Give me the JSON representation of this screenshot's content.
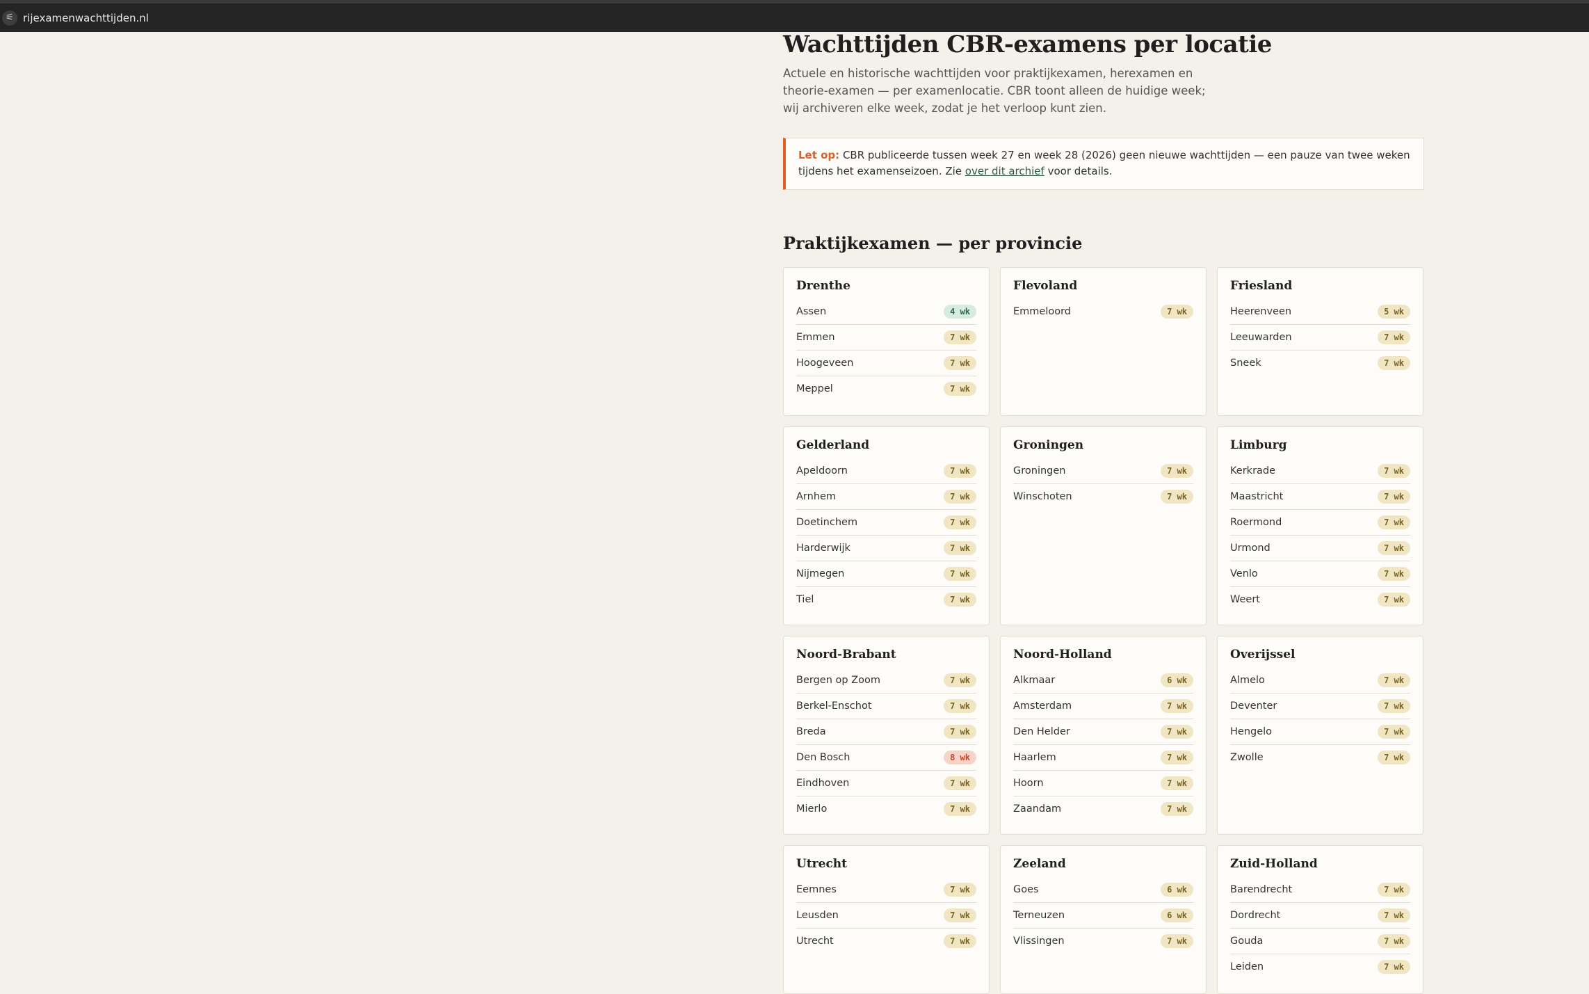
{
  "browser": {
    "url": "rijexamenwachttijden.nl",
    "site_icon": "tune-icon"
  },
  "page": {
    "title": "Wachttijden CBR-examens per locatie",
    "lead": "Actuele en historische wachttijden voor praktijkexamen, herexamen en theorie-examen — per examenlocatie. CBR toont alleen de huidige week; wij archiveren elke week, zodat je het verloop kunt zien."
  },
  "notice": {
    "label": "Let op:",
    "text_before": " CBR publiceerde tussen week 27 en week 28 (2026) geen nieuwe wachttijden — een pauze van twee weken tijdens het examenseizoen. Zie ",
    "link": "over dit archief",
    "text_after": " voor details."
  },
  "section": {
    "title": "Praktijkexamen — per provincie"
  },
  "colors": {
    "accent": "#d9622b",
    "badge_default": "#f1e6c4",
    "badge_low": "#d7ece0",
    "badge_high": "#f7d4c8"
  },
  "provinces": [
    {
      "name": "Drenthe",
      "locations": [
        {
          "name": "Assen",
          "wait": "4 wk",
          "level": "green"
        },
        {
          "name": "Emmen",
          "wait": "7 wk",
          "level": "default"
        },
        {
          "name": "Hoogeveen",
          "wait": "7 wk",
          "level": "default"
        },
        {
          "name": "Meppel",
          "wait": "7 wk",
          "level": "default"
        }
      ]
    },
    {
      "name": "Flevoland",
      "locations": [
        {
          "name": "Emmeloord",
          "wait": "7 wk",
          "level": "default"
        }
      ]
    },
    {
      "name": "Friesland",
      "locations": [
        {
          "name": "Heerenveen",
          "wait": "5 wk",
          "level": "default"
        },
        {
          "name": "Leeuwarden",
          "wait": "7 wk",
          "level": "default"
        },
        {
          "name": "Sneek",
          "wait": "7 wk",
          "level": "default"
        }
      ]
    },
    {
      "name": "Gelderland",
      "locations": [
        {
          "name": "Apeldoorn",
          "wait": "7 wk",
          "level": "default"
        },
        {
          "name": "Arnhem",
          "wait": "7 wk",
          "level": "default"
        },
        {
          "name": "Doetinchem",
          "wait": "7 wk",
          "level": "default"
        },
        {
          "name": "Harderwijk",
          "wait": "7 wk",
          "level": "default"
        },
        {
          "name": "Nijmegen",
          "wait": "7 wk",
          "level": "default"
        },
        {
          "name": "Tiel",
          "wait": "7 wk",
          "level": "default"
        }
      ]
    },
    {
      "name": "Groningen",
      "locations": [
        {
          "name": "Groningen",
          "wait": "7 wk",
          "level": "default"
        },
        {
          "name": "Winschoten",
          "wait": "7 wk",
          "level": "default"
        }
      ]
    },
    {
      "name": "Limburg",
      "locations": [
        {
          "name": "Kerkrade",
          "wait": "7 wk",
          "level": "default"
        },
        {
          "name": "Maastricht",
          "wait": "7 wk",
          "level": "default"
        },
        {
          "name": "Roermond",
          "wait": "7 wk",
          "level": "default"
        },
        {
          "name": "Urmond",
          "wait": "7 wk",
          "level": "default"
        },
        {
          "name": "Venlo",
          "wait": "7 wk",
          "level": "default"
        },
        {
          "name": "Weert",
          "wait": "7 wk",
          "level": "default"
        }
      ]
    },
    {
      "name": "Noord-Brabant",
      "locations": [
        {
          "name": "Bergen op Zoom",
          "wait": "7 wk",
          "level": "default"
        },
        {
          "name": "Berkel-Enschot",
          "wait": "7 wk",
          "level": "default"
        },
        {
          "name": "Breda",
          "wait": "7 wk",
          "level": "default"
        },
        {
          "name": "Den Bosch",
          "wait": "8 wk",
          "level": "red"
        },
        {
          "name": "Eindhoven",
          "wait": "7 wk",
          "level": "default"
        },
        {
          "name": "Mierlo",
          "wait": "7 wk",
          "level": "default"
        }
      ]
    },
    {
      "name": "Noord-Holland",
      "locations": [
        {
          "name": "Alkmaar",
          "wait": "6 wk",
          "level": "default"
        },
        {
          "name": "Amsterdam",
          "wait": "7 wk",
          "level": "default"
        },
        {
          "name": "Den Helder",
          "wait": "7 wk",
          "level": "default"
        },
        {
          "name": "Haarlem",
          "wait": "7 wk",
          "level": "default"
        },
        {
          "name": "Hoorn",
          "wait": "7 wk",
          "level": "default"
        },
        {
          "name": "Zaandam",
          "wait": "7 wk",
          "level": "default"
        }
      ]
    },
    {
      "name": "Overijssel",
      "locations": [
        {
          "name": "Almelo",
          "wait": "7 wk",
          "level": "default"
        },
        {
          "name": "Deventer",
          "wait": "7 wk",
          "level": "default"
        },
        {
          "name": "Hengelo",
          "wait": "7 wk",
          "level": "default"
        },
        {
          "name": "Zwolle",
          "wait": "7 wk",
          "level": "default"
        }
      ]
    },
    {
      "name": "Utrecht",
      "locations": [
        {
          "name": "Eemnes",
          "wait": "7 wk",
          "level": "default"
        },
        {
          "name": "Leusden",
          "wait": "7 wk",
          "level": "default"
        },
        {
          "name": "Utrecht",
          "wait": "7 wk",
          "level": "default"
        }
      ]
    },
    {
      "name": "Zeeland",
      "locations": [
        {
          "name": "Goes",
          "wait": "6 wk",
          "level": "default"
        },
        {
          "name": "Terneuzen",
          "wait": "6 wk",
          "level": "default"
        },
        {
          "name": "Vlissingen",
          "wait": "7 wk",
          "level": "default"
        }
      ]
    },
    {
      "name": "Zuid-Holland",
      "locations": [
        {
          "name": "Barendrecht",
          "wait": "7 wk",
          "level": "default"
        },
        {
          "name": "Dordrecht",
          "wait": "7 wk",
          "level": "default"
        },
        {
          "name": "Gouda",
          "wait": "7 wk",
          "level": "default"
        },
        {
          "name": "Leiden",
          "wait": "7 wk",
          "level": "default"
        }
      ]
    }
  ]
}
